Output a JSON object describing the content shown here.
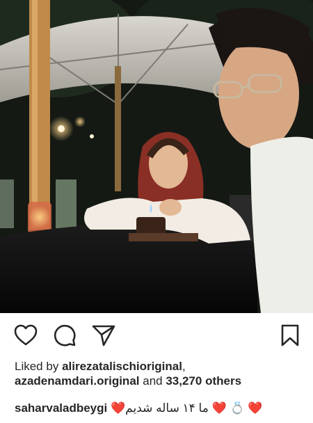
{
  "post": {
    "photo_alt": "photo",
    "actions": {
      "like_icon": "heart-outline-icon",
      "comment_icon": "comment-icon",
      "share_icon": "paper-plane-icon",
      "save_icon": "bookmark-icon"
    },
    "likes": {
      "prefix": "Liked by",
      "user1": "alirezatalischioriginal",
      "comma": ",",
      "user2": "azadenamdari.original",
      "and_text": "and",
      "others": "33,270 others"
    },
    "caption": {
      "username": "saharvaladbeygi",
      "text_before": "ما ۱۴ ساله شدیم",
      "emoji_heart": "❤️",
      "emoji_ring": "💍"
    }
  },
  "colors": {
    "text": "#262626",
    "heart": "#e0245e"
  }
}
